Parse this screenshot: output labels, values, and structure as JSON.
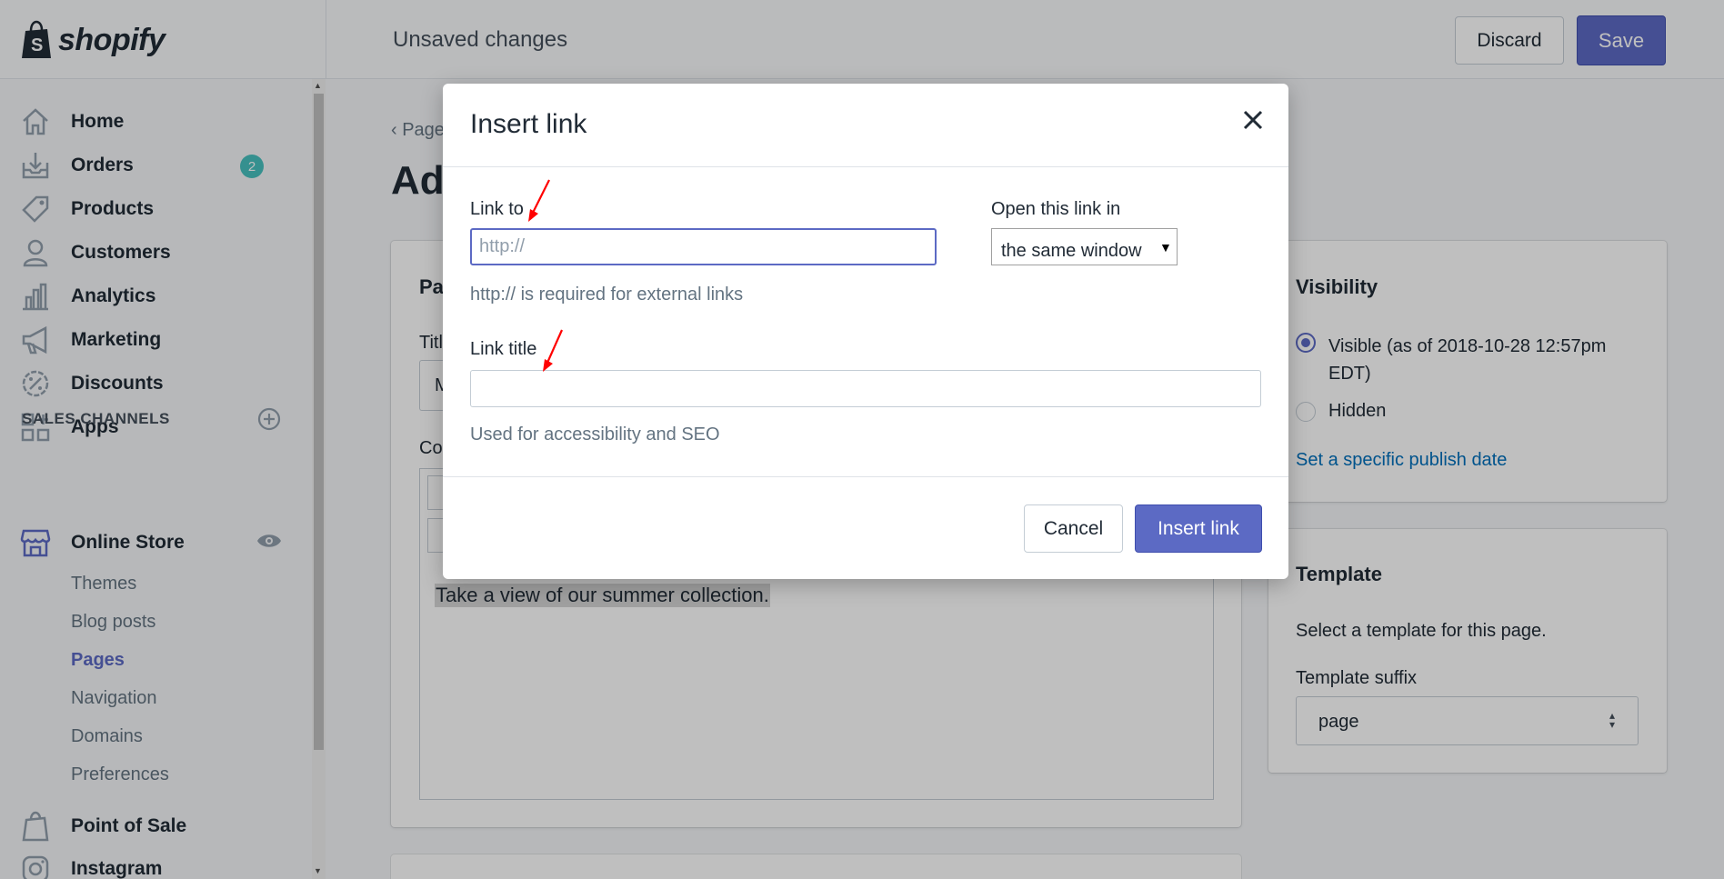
{
  "topbar": {
    "brand": "shopify",
    "status": "Unsaved changes",
    "discard_label": "Discard",
    "save_label": "Save"
  },
  "sidebar": {
    "items": [
      {
        "label": "Home",
        "icon": "home-icon"
      },
      {
        "label": "Orders",
        "icon": "orders-icon",
        "badge": "2"
      },
      {
        "label": "Products",
        "icon": "tag-icon"
      },
      {
        "label": "Customers",
        "icon": "person-icon"
      },
      {
        "label": "Analytics",
        "icon": "bar-chart-icon"
      },
      {
        "label": "Marketing",
        "icon": "megaphone-icon"
      },
      {
        "label": "Discounts",
        "icon": "discount-icon"
      },
      {
        "label": "Apps",
        "icon": "apps-icon"
      }
    ],
    "sales_channels_title": "SALES CHANNELS",
    "online_store": "Online Store",
    "sub_items": [
      "Themes",
      "Blog posts",
      "Pages",
      "Navigation",
      "Domains",
      "Preferences"
    ],
    "active_sub_item": "Pages",
    "point_of_sale": "Point of Sale",
    "instagram": "Instagram"
  },
  "main": {
    "breadcrumb": "Page",
    "page_title": "Ad",
    "card_heading": "Pa",
    "title_label": "Titl",
    "title_value": "M",
    "content_label": "Co",
    "editor_text": "Take a view of our summer collection.",
    "visibility": {
      "title": "Visibility",
      "visible_option": "Visible (as of 2018-10-28 12:57pm EDT)",
      "hidden_option": "Hidden",
      "selected": "Visible",
      "publish_link": "Set a specific publish date"
    },
    "template": {
      "title": "Template",
      "description": "Select a template for this page.",
      "suffix_label": "Template suffix",
      "suffix_value": "page"
    }
  },
  "modal": {
    "title": "Insert link",
    "link_to_label": "Link to",
    "link_to_placeholder": "http://",
    "link_to_value": "",
    "link_to_help": "http:// is required for external links",
    "open_in_label": "Open this link in",
    "open_in_value": "the same window",
    "link_title_label": "Link title",
    "link_title_value": "",
    "link_title_help": "Used for accessibility and SEO",
    "cancel_label": "Cancel",
    "insert_label": "Insert link"
  },
  "colors": {
    "accent": "#5c6ac4",
    "badge": "#47c1bf",
    "link": "#006fbb",
    "annotation_arrow": "#ff0000"
  }
}
